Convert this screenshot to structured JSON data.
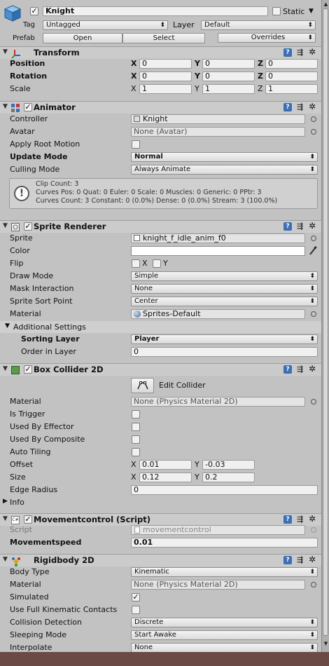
{
  "object": {
    "name": "Knight",
    "active": "✓",
    "static_label": "Static",
    "tag_label": "Tag",
    "tag_value": "Untagged",
    "layer_label": "Layer",
    "layer_value": "Default",
    "prefab_label": "Prefab",
    "open_label": "Open",
    "select_label": "Select",
    "overrides_label": "Overrides"
  },
  "transform": {
    "title": "Transform",
    "position_label": "Position",
    "rotation_label": "Rotation",
    "scale_label": "Scale",
    "x": "X",
    "y": "Y",
    "z": "Z",
    "px": "0",
    "py": "0",
    "pz": "0",
    "rx": "0",
    "ry": "0",
    "rz": "0",
    "sx": "1",
    "sy": "1",
    "sz": "1"
  },
  "animator": {
    "title": "Animator",
    "controller_label": "Controller",
    "controller_value": "Knight",
    "avatar_label": "Avatar",
    "avatar_value": "None (Avatar)",
    "apply_root_label": "Apply Root Motion",
    "update_mode_label": "Update Mode",
    "update_mode_value": "Normal",
    "culling_label": "Culling Mode",
    "culling_value": "Always Animate",
    "info_line1": "Clip Count: 3",
    "info_line2": "Curves Pos: 0 Quat: 0 Euler: 0 Scale: 0 Muscles: 0 Generic: 0 PPtr: 3",
    "info_line3": "Curves Count: 3 Constant: 0 (0.0%) Dense: 0 (0.0%) Stream: 3 (100.0%)"
  },
  "sprite_renderer": {
    "title": "Sprite Renderer",
    "sprite_label": "Sprite",
    "sprite_value": "knight_f_idle_anim_f0",
    "color_label": "Color",
    "color_value": "#ffffff",
    "flip_label": "Flip",
    "flip_x": "X",
    "flip_y": "Y",
    "draw_mode_label": "Draw Mode",
    "draw_mode_value": "Simple",
    "mask_label": "Mask Interaction",
    "mask_value": "None",
    "sort_point_label": "Sprite Sort Point",
    "sort_point_value": "Center",
    "material_label": "Material",
    "material_value": "Sprites-Default",
    "additional_label": "Additional Settings",
    "sorting_layer_label": "Sorting Layer",
    "sorting_layer_value": "Player",
    "order_label": "Order in Layer",
    "order_value": "0"
  },
  "box_collider": {
    "title": "Box Collider 2D",
    "edit_label": "Edit Collider",
    "material_label": "Material",
    "material_value": "None (Physics Material 2D)",
    "trigger_label": "Is Trigger",
    "effector_label": "Used By Effector",
    "composite_label": "Used By Composite",
    "tiling_label": "Auto Tiling",
    "offset_label": "Offset",
    "offset_x": "0.01",
    "offset_y": "-0.03",
    "size_label": "Size",
    "size_x": "0.12",
    "size_y": "0.2",
    "edge_label": "Edge Radius",
    "edge_value": "0",
    "info_label": "Info",
    "x": "X",
    "y": "Y"
  },
  "movement": {
    "title": "Movementcontrol (Script)",
    "script_label": "Script",
    "script_value": "movementcontrol",
    "speed_label": "Movementspeed",
    "speed_value": "0.01"
  },
  "rigidbody": {
    "title": "Rigidbody 2D",
    "body_type_label": "Body Type",
    "body_type_value": "Kinematic",
    "material_label": "Material",
    "material_value": "None (Physics Material 2D)",
    "simulated_label": "Simulated",
    "simulated_check": "✓",
    "kinematic_contacts_label": "Use Full Kinematic Contacts",
    "collision_label": "Collision Detection",
    "collision_value": "Discrete",
    "sleeping_label": "Sleeping Mode",
    "sleeping_value": "Start Awake",
    "interpolate_label": "Interpolate",
    "interpolate_value": "None"
  },
  "icons": {
    "dropdown_arrow": "⬍",
    "gear": "✲",
    "fold_open": "▼",
    "fold_closed": "▶",
    "target": "⊙",
    "preset": "⇶",
    "book": "?",
    "checkmark": "✓"
  }
}
